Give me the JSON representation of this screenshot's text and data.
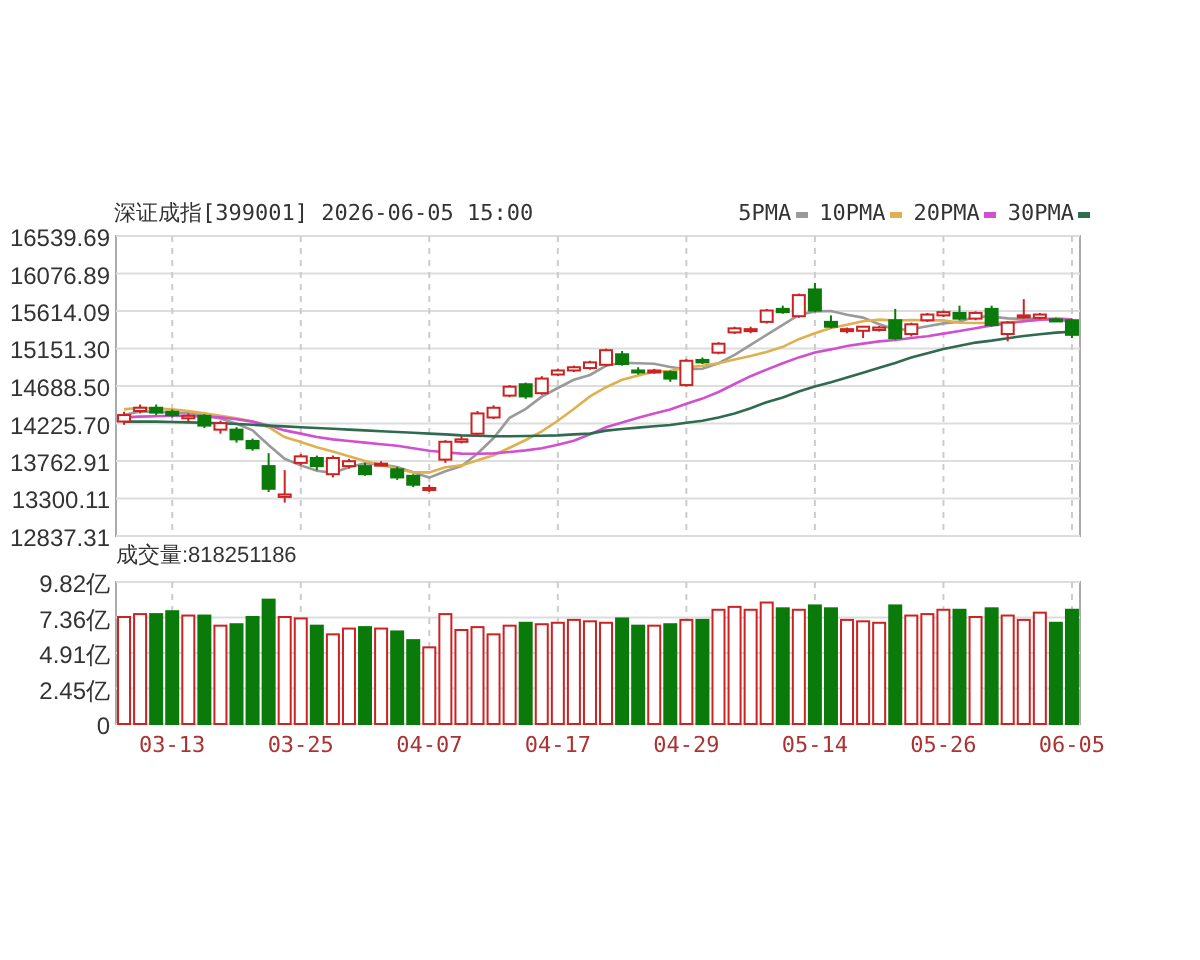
{
  "header": {
    "title": "深证成指[399001] 2026-06-05 15:00"
  },
  "price_chart": {
    "candles": {
      "chart_data": {
        "type": "candlestick",
        "ylim": [
          12837.31,
          16539.69
        ],
        "ohlc": [
          [
            14250,
            14370,
            14210,
            14330
          ],
          [
            14380,
            14460,
            14350,
            14420
          ],
          [
            14420,
            14460,
            14330,
            14360
          ],
          [
            14370,
            14400,
            14300,
            14330
          ],
          [
            14290,
            14350,
            14250,
            14320
          ],
          [
            14320,
            14340,
            14170,
            14200
          ],
          [
            14150,
            14260,
            14100,
            14230
          ],
          [
            14150,
            14180,
            13990,
            14030
          ],
          [
            14010,
            14040,
            13890,
            13920
          ],
          [
            13700,
            13860,
            13380,
            13420
          ],
          [
            13320,
            13650,
            13250,
            13350
          ],
          [
            13740,
            13850,
            13710,
            13820
          ],
          [
            13800,
            13830,
            13650,
            13700
          ],
          [
            13600,
            13830,
            13560,
            13800
          ],
          [
            13700,
            13790,
            13670,
            13760
          ],
          [
            13700,
            13740,
            13580,
            13600
          ],
          [
            13720,
            13760,
            13700,
            13730
          ],
          [
            13660,
            13690,
            13530,
            13560
          ],
          [
            13580,
            13600,
            13440,
            13470
          ],
          [
            13420,
            13470,
            13380,
            13430
          ],
          [
            13780,
            14020,
            13740,
            14000
          ],
          [
            14000,
            14070,
            13980,
            14030
          ],
          [
            14100,
            14380,
            14080,
            14350
          ],
          [
            14300,
            14450,
            14280,
            14420
          ],
          [
            14570,
            14700,
            14550,
            14680
          ],
          [
            14710,
            14730,
            14530,
            14560
          ],
          [
            14600,
            14810,
            14580,
            14780
          ],
          [
            14830,
            14900,
            14810,
            14880
          ],
          [
            14880,
            14940,
            14860,
            14920
          ],
          [
            14910,
            15000,
            14890,
            14980
          ],
          [
            14950,
            15150,
            14930,
            15130
          ],
          [
            15080,
            15120,
            14940,
            14960
          ],
          [
            14880,
            14920,
            14830,
            14860
          ],
          [
            14860,
            14900,
            14840,
            14880
          ],
          [
            14860,
            14880,
            14740,
            14780
          ],
          [
            14700,
            15020,
            14680,
            15000
          ],
          [
            15010,
            15040,
            14960,
            14980
          ],
          [
            15100,
            15230,
            15080,
            15210
          ],
          [
            15350,
            15420,
            15330,
            15400
          ],
          [
            15380,
            15420,
            15340,
            15390
          ],
          [
            15480,
            15640,
            15460,
            15620
          ],
          [
            15640,
            15680,
            15580,
            15600
          ],
          [
            15550,
            15830,
            15530,
            15810
          ],
          [
            15880,
            15960,
            15600,
            15620
          ],
          [
            15480,
            15560,
            15400,
            15420
          ],
          [
            15370,
            15410,
            15340,
            15390
          ],
          [
            15370,
            15430,
            15280,
            15420
          ],
          [
            15380,
            15430,
            15360,
            15410
          ],
          [
            15500,
            15640,
            15260,
            15280
          ],
          [
            15330,
            15470,
            15300,
            15450
          ],
          [
            15500,
            15590,
            15480,
            15570
          ],
          [
            15560,
            15620,
            15540,
            15600
          ],
          [
            15590,
            15680,
            15500,
            15520
          ],
          [
            15520,
            15610,
            15500,
            15590
          ],
          [
            15640,
            15680,
            15420,
            15440
          ],
          [
            15330,
            15490,
            15240,
            15470
          ],
          [
            15540,
            15760,
            15520,
            15560
          ],
          [
            15530,
            15590,
            15510,
            15570
          ],
          [
            15510,
            15530,
            15480,
            15500
          ],
          [
            15500,
            15520,
            15280,
            15320
          ]
        ]
      }
    },
    "chart_data": {
      "type": "line",
      "grid": true,
      "ylim": [
        12837.31,
        16539.69
      ],
      "yticks": [
        {
          "value": 16539.69,
          "label": "16539.69"
        },
        {
          "value": 16076.89,
          "label": "16076.89"
        },
        {
          "value": 15614.09,
          "label": "15614.09"
        },
        {
          "value": 15151.3,
          "label": "15151.30"
        },
        {
          "value": 14688.5,
          "label": "14688.50"
        },
        {
          "value": 14225.7,
          "label": "14225.70"
        },
        {
          "value": 13762.91,
          "label": "13762.91"
        },
        {
          "value": 13300.11,
          "label": "13300.11"
        },
        {
          "value": 12837.31,
          "label": "12837.31"
        }
      ],
      "series": [
        {
          "name": "5PMA",
          "color": "#9a9a9a",
          "values": [
            14330,
            14375,
            14370,
            14360,
            14352,
            14326,
            14288,
            14222,
            14140,
            13960,
            13790,
            13708,
            13642,
            13618,
            13686,
            13736,
            13718,
            13690,
            13624,
            13558,
            13638,
            13698,
            13856,
            14046,
            14296,
            14408,
            14558,
            14664,
            14764,
            14824,
            14938,
            14974,
            14970,
            14962,
            14922,
            14896,
            14900,
            14970,
            15074,
            15196,
            15320,
            15444,
            15564,
            15608,
            15614,
            15568,
            15532,
            15452,
            15384,
            15390,
            15426,
            15462,
            15484,
            15546,
            15544,
            15524,
            15516,
            15526,
            15508,
            15484
          ]
        },
        {
          "name": "10PMA",
          "color": "#e0b050",
          "values": [
            14400,
            14420,
            14410,
            14400,
            14380,
            14350,
            14320,
            14290,
            14250,
            14180,
            14058,
            13998,
            13932,
            13879,
            13823,
            13763,
            13713,
            13666,
            13621,
            13622,
            13687,
            13708,
            13773,
            13835,
            13927,
            14023,
            14128,
            14260,
            14405,
            14560,
            14673,
            14766,
            14817,
            14863,
            14873,
            14917,
            14937,
            14970,
            15018,
            15059,
            15108,
            15172,
            15267,
            15341,
            15405,
            15444,
            15488,
            15508,
            15496,
            15502,
            15497,
            15497,
            15468,
            15465,
            15467,
            15475,
            15489,
            15505,
            15527,
            15514
          ]
        },
        {
          "name": "20PMA",
          "color": "#d050d0",
          "values": [
            14300,
            14310,
            14315,
            14320,
            14320,
            14310,
            14300,
            14280,
            14250,
            14200,
            14140,
            14100,
            14060,
            14030,
            14010,
            13990,
            13970,
            13950,
            13920,
            13890,
            13872,
            13853,
            13852,
            13857,
            13875,
            13893,
            13920,
            13963,
            14013,
            14091,
            14180,
            14237,
            14295,
            14349,
            14400,
            14470,
            14533,
            14615,
            14712,
            14810,
            14891,
            14969,
            15042,
            15102,
            15139,
            15181,
            15213,
            15239,
            15257,
            15281,
            15303,
            15335,
            15368,
            15403,
            15436,
            15460,
            15489,
            15507,
            15512,
            15508
          ]
        },
        {
          "name": "30PMA",
          "color": "#2e6b4f",
          "values": [
            14250,
            14250,
            14250,
            14245,
            14240,
            14235,
            14230,
            14220,
            14210,
            14200,
            14190,
            14180,
            14170,
            14160,
            14150,
            14140,
            14130,
            14120,
            14110,
            14100,
            14090,
            14080,
            14075,
            14070,
            14070,
            14072,
            14075,
            14080,
            14090,
            14100,
            14139,
            14157,
            14174,
            14192,
            14208,
            14234,
            14259,
            14299,
            14348,
            14414,
            14489,
            14549,
            14619,
            14680,
            14735,
            14795,
            14851,
            14913,
            14973,
            15040,
            15093,
            15145,
            15184,
            15223,
            15248,
            15279,
            15305,
            15328,
            15347,
            15358
          ]
        }
      ]
    }
  },
  "volume": {
    "label": "成交量:818251186",
    "chart_data": {
      "type": "bar",
      "grid": true,
      "ylim": [
        0,
        9.82
      ],
      "yticks": [
        {
          "value": 9.82,
          "label": "9.82亿"
        },
        {
          "value": 7.36,
          "label": "7.36亿"
        },
        {
          "value": 4.91,
          "label": "4.91亿"
        },
        {
          "value": 2.45,
          "label": "2.45亿"
        },
        {
          "value": 0,
          "label": "0"
        }
      ],
      "categories": [
        null,
        null,
        null,
        "03-13",
        null,
        null,
        null,
        null,
        null,
        null,
        null,
        "03-25",
        null,
        null,
        null,
        null,
        null,
        null,
        null,
        "04-07",
        null,
        null,
        null,
        null,
        null,
        null,
        null,
        "04-17",
        null,
        null,
        null,
        null,
        null,
        null,
        null,
        "04-29",
        null,
        null,
        null,
        null,
        null,
        null,
        null,
        "05-14",
        null,
        null,
        null,
        null,
        null,
        null,
        null,
        "05-26",
        null,
        null,
        null,
        null,
        null,
        null,
        null,
        "06-05"
      ],
      "values": [
        7.4,
        7.6,
        7.6,
        7.8,
        7.5,
        7.5,
        6.8,
        6.9,
        7.4,
        8.6,
        7.4,
        7.3,
        6.8,
        6.2,
        6.6,
        6.7,
        6.6,
        6.4,
        5.8,
        5.3,
        7.6,
        6.5,
        6.7,
        6.2,
        6.8,
        7.0,
        6.9,
        7.0,
        7.2,
        7.1,
        7.0,
        7.3,
        6.8,
        6.8,
        6.9,
        7.2,
        7.2,
        7.9,
        8.1,
        7.9,
        8.4,
        8.0,
        7.9,
        8.2,
        8.0,
        7.2,
        7.1,
        7.0,
        8.2,
        7.5,
        7.6,
        7.9,
        7.9,
        7.4,
        8.0,
        7.5,
        7.2,
        7.7,
        7.0,
        7.9
      ]
    }
  }
}
